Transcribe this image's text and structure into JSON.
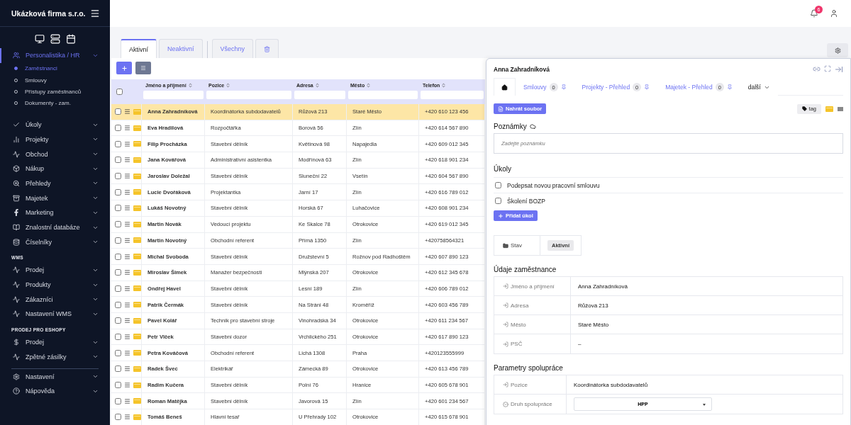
{
  "topbar": {
    "notifications": "6"
  },
  "sidebar": {
    "brand": "Ukázková firma s.r.o.",
    "sections": [
      {
        "items": [
          {
            "label": "Personalistika / HR",
            "selected": true,
            "children": [
              {
                "label": "Zaměstnanci",
                "selected": true
              },
              {
                "label": "Smlouvy",
                "selected": false
              },
              {
                "label": "Přístupy zaměstnanců",
                "selected": false
              },
              {
                "label": "Dokumenty - zam.",
                "selected": false
              }
            ]
          },
          {
            "label": "Úkoly",
            "selected": false
          },
          {
            "label": "Projekty",
            "selected": false
          },
          {
            "label": "Obchod",
            "selected": false
          },
          {
            "label": "Nákup",
            "selected": false
          },
          {
            "label": "Přehledy",
            "selected": false
          },
          {
            "label": "Majetek",
            "selected": false
          },
          {
            "label": "Marketing",
            "selected": false
          },
          {
            "label": "Znalostní databáze",
            "selected": false
          },
          {
            "label": "Číselníky",
            "selected": false
          }
        ]
      },
      {
        "heading": "WMS",
        "items": [
          {
            "label": "Prodej",
            "selected": false
          },
          {
            "label": "Produkty",
            "selected": false
          },
          {
            "label": "Zákazníci",
            "selected": false
          },
          {
            "label": "Nastavení WMS",
            "selected": false
          }
        ]
      },
      {
        "heading": "PRODEJ PRO ESHOPY",
        "items": [
          {
            "label": "Prodej",
            "selected": false
          },
          {
            "label": "Zpětné zásilky",
            "selected": false
          }
        ]
      },
      {
        "items": [
          {
            "label": "Nastavení",
            "selected": false
          },
          {
            "label": "Nápověda",
            "selected": false
          }
        ]
      }
    ]
  },
  "tabs": [
    {
      "kind": "text",
      "label": "Aktivní",
      "selected": true
    },
    {
      "kind": "text",
      "label": "Neaktivní",
      "selected": false
    },
    {
      "kind": "text",
      "label": "Všechny",
      "selected": false
    },
    {
      "kind": "trash",
      "selected": false
    }
  ],
  "table": {
    "select_all": {
      "checked": false
    },
    "columns": [
      "Jméno a příjmení",
      "Pozice",
      "Adresa",
      "Město",
      "Telefon"
    ],
    "rows": [
      {
        "name": "Anna Zahradníková",
        "position": "Koordinátorka subdodavatelů",
        "address": "Růžová 213",
        "city": "Staré Město",
        "phone": "+420 610 123 456",
        "selected": true,
        "checked": false
      },
      {
        "name": "Eva Hradilová",
        "position": "Rozpočtářka",
        "address": "Borová 56",
        "city": "Zlín",
        "phone": "+420 614 567 890",
        "selected": false,
        "checked": false
      },
      {
        "name": "Filip Procházka",
        "position": "Stavební dělník",
        "address": "Květinová 98",
        "city": "Napajedla",
        "phone": "+420 609 012 345",
        "selected": false,
        "checked": false
      },
      {
        "name": "Jana Kovářová",
        "position": "Administrativní asistentka",
        "address": "Modřínová 63",
        "city": "Zlín",
        "phone": "+420 618 901 234",
        "selected": false,
        "checked": false
      },
      {
        "name": "Jaroslav Doležal",
        "position": "Stavební dělník",
        "address": "Sluneční 22",
        "city": "Vsetín",
        "phone": "+420 604 567 890",
        "selected": false,
        "checked": false
      },
      {
        "name": "Lucie Dvořáková",
        "position": "Projektantka",
        "address": "Jarní 17",
        "city": "Zlín",
        "phone": "+420 616 789 012",
        "selected": false,
        "checked": false
      },
      {
        "name": "Lukáš Novotný",
        "position": "Stavební dělník",
        "address": "Horská 67",
        "city": "Luhačovice",
        "phone": "+420 608 901 234",
        "selected": false,
        "checked": false
      },
      {
        "name": "Martin Novák",
        "position": "Vedoucí projektu",
        "address": "Ke Skalce 78",
        "city": "Otrokovice",
        "phone": "+420 619 012 345",
        "selected": false,
        "checked": false
      },
      {
        "name": "Martin Novotný",
        "position": "Obchodní referent",
        "address": "Přímá 1350",
        "city": "Zlín",
        "phone": "+420758564321",
        "selected": false,
        "checked": false
      },
      {
        "name": "Michal Svoboda",
        "position": "Stavební dělník",
        "address": "Družstevní 5",
        "city": "Rožnov pod Radhoštěm",
        "phone": "+420 607 890 123",
        "selected": false,
        "checked": false
      },
      {
        "name": "Miroslav Šimek",
        "position": "Manažer bezpečnosti",
        "address": "Mlýnská 207",
        "city": "Otrokovice",
        "phone": "+420 612 345 678",
        "selected": false,
        "checked": false
      },
      {
        "name": "Ondřej Havel",
        "position": "Stavební dělník",
        "address": "Lesní 189",
        "city": "Zlín",
        "phone": "+420 606 789 012",
        "selected": false,
        "checked": false
      },
      {
        "name": "Patrik Čermák",
        "position": "Stavební dělník",
        "address": "Na Stráni 48",
        "city": "Kroměříž",
        "phone": "+420 603 456 789",
        "selected": false,
        "checked": false
      },
      {
        "name": "Pavel Kolář",
        "position": "Technik pro stavební stroje",
        "address": "Vinohradská 34",
        "city": "Otrokovice",
        "phone": "+420 611 234 567",
        "selected": false,
        "checked": false
      },
      {
        "name": "Petr Vlček",
        "position": "Stavební dozor",
        "address": "Vrchlického 251",
        "city": "Otrokovice",
        "phone": "+420 617 890 123",
        "selected": false,
        "checked": false
      },
      {
        "name": "Petra Kováčová",
        "position": "Obchodní referent",
        "address": "Lichá 1308",
        "city": "Praha",
        "phone": "+420123555999",
        "selected": false,
        "checked": false
      },
      {
        "name": "Radek Švec",
        "position": "Elektrikář",
        "address": "Zámecká 89",
        "city": "Otrokovice",
        "phone": "+420 613 456 789",
        "selected": false,
        "checked": false
      },
      {
        "name": "Radim Kučera",
        "position": "Stavební dělník",
        "address": "Polní 76",
        "city": "Hranice",
        "phone": "+420 605 678 901",
        "selected": false,
        "checked": false
      },
      {
        "name": "Roman Matějka",
        "position": "Stavební dělník",
        "address": "Javorová 15",
        "city": "Zlín",
        "phone": "+420 601 234 567",
        "selected": false,
        "checked": false
      },
      {
        "name": "Tomáš Beneš",
        "position": "Hlavní tesař",
        "address": "U Přehrady 102",
        "city": "Otrokovice",
        "phone": "+420 615 678 901",
        "selected": false,
        "checked": false
      }
    ]
  },
  "panel": {
    "title": "Anna Zahradníková",
    "tabs": [
      {
        "kind": "home",
        "selected": true
      },
      {
        "kind": "pinned",
        "label": "Smlouvy",
        "count": "0",
        "selected": false
      },
      {
        "kind": "pinned",
        "label": "Projekty - Přehled",
        "count": "0",
        "selected": false
      },
      {
        "kind": "pinned",
        "label": "Majetek - Přehled",
        "count": "0",
        "selected": false
      },
      {
        "kind": "more",
        "label": "další",
        "selected": false
      }
    ],
    "upload_button": "Nahrát soubor",
    "tag_button": "tag",
    "notes": {
      "title": "Poznámky",
      "placeholder": "Zadejte poznámku"
    },
    "tasks": {
      "title": "Úkoly",
      "items": [
        {
          "label": "Podepsat novou pracovní smlouvu",
          "checked": false
        },
        {
          "label": "Školení BOZP",
          "checked": false
        }
      ],
      "add_button": "Přidat úkol"
    },
    "status": {
      "label": "Stav",
      "value": "Aktivní"
    },
    "employee": {
      "title": "Údaje zaměstnance",
      "fields": [
        {
          "kind": "text",
          "label": "Jméno a příjmení",
          "value": "Anna Zahradníková"
        },
        {
          "kind": "text",
          "label": "Adresa",
          "value": "Růžová 213"
        },
        {
          "kind": "text",
          "label": "Město",
          "value": "Staré Město"
        },
        {
          "kind": "text",
          "label": "PSČ",
          "value": "–"
        }
      ]
    },
    "cooperation": {
      "title": "Parametry spolupráce",
      "fields": [
        {
          "kind": "text",
          "label": "Pozice",
          "value": "Koordinátorka subdodavatelů"
        },
        {
          "kind": "select",
          "label": "Druh spolupráce",
          "value": "HPP"
        }
      ]
    }
  }
}
